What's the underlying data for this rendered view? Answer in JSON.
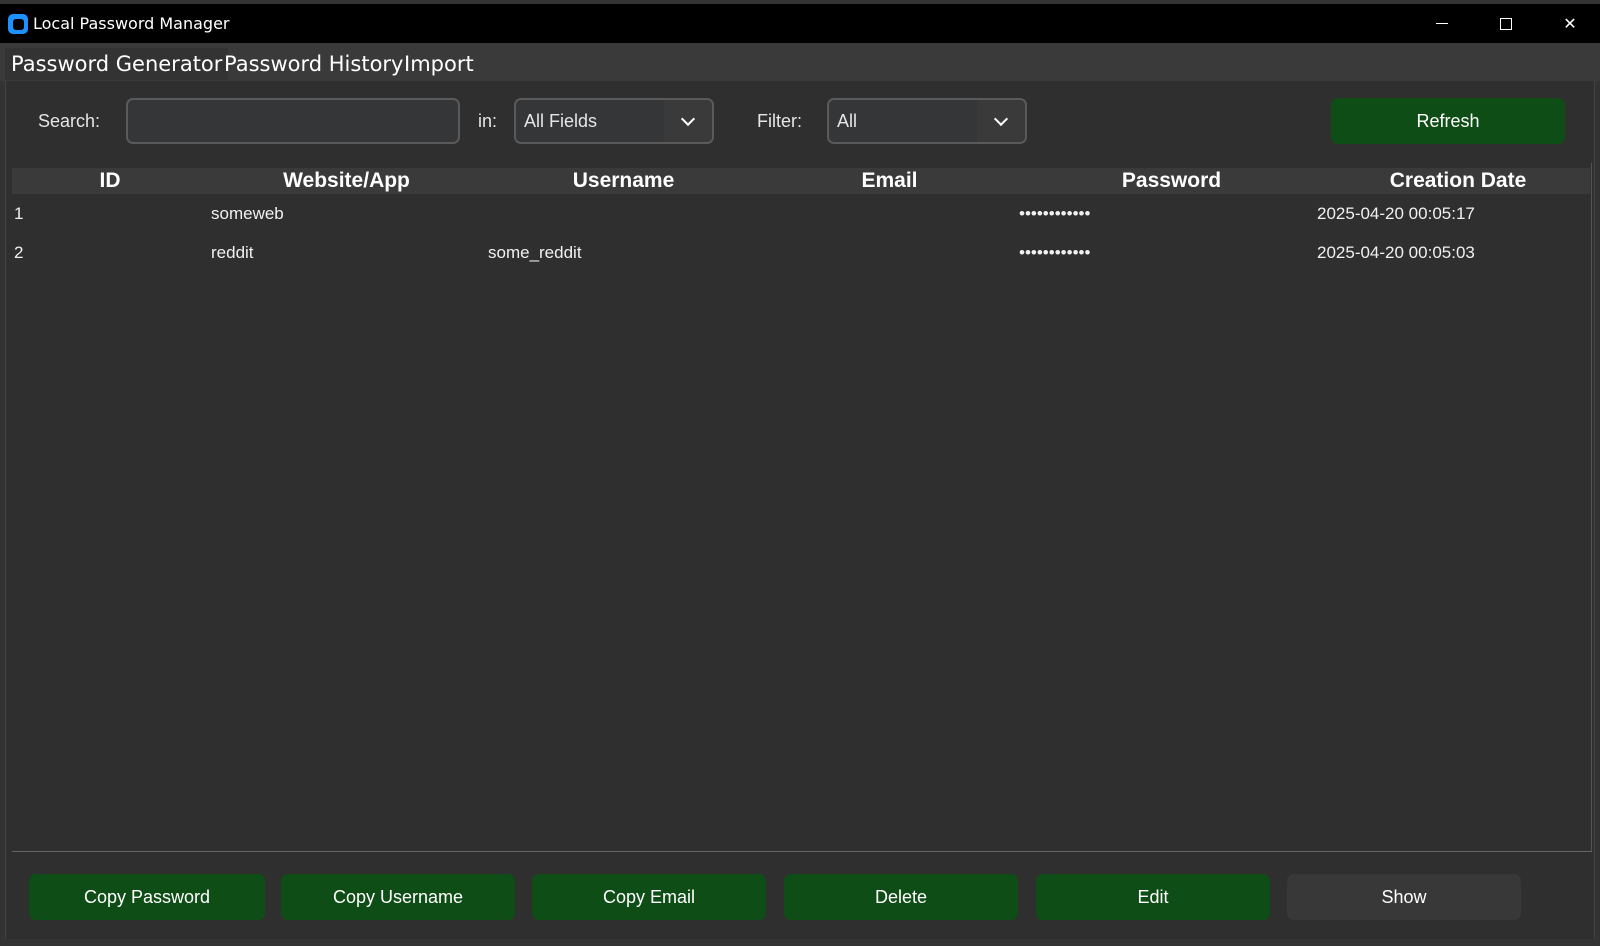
{
  "window": {
    "title": "Local Password Manager",
    "controls": {
      "minimize": "minimize",
      "maximize": "maximize",
      "close": "✕"
    }
  },
  "tabs": [
    {
      "label": "Password Generator",
      "active": true
    },
    {
      "label": "Password History",
      "active": false
    },
    {
      "label": "Import",
      "active": false
    }
  ],
  "toolbar": {
    "search_label": "Search:",
    "search_value": "",
    "in_label": "in:",
    "in_select_value": "All Fields",
    "filter_label": "Filter:",
    "filter_select_value": "All",
    "refresh_label": "Refresh"
  },
  "table": {
    "columns": [
      "ID",
      "Website/App",
      "Username",
      "Email",
      "Password",
      "Creation Date"
    ],
    "rows": [
      {
        "id": "1",
        "website": "someweb",
        "username": "",
        "email": "",
        "password": "••••••••••••",
        "created": "2025-04-20 00:05:17"
      },
      {
        "id": "2",
        "website": "reddit",
        "username": "some_reddit",
        "email": "",
        "password": "••••••••••••",
        "created": "2025-04-20 00:05:03"
      }
    ]
  },
  "actions": {
    "copy_password": "Copy Password",
    "copy_username": "Copy Username",
    "copy_email": "Copy Email",
    "delete": "Delete",
    "edit": "Edit",
    "show": "Show"
  },
  "colors": {
    "accent_green": "#0f4d17",
    "background": "#2f2f2f",
    "titlebar": "#000000",
    "app_icon": "#1e90ff"
  }
}
